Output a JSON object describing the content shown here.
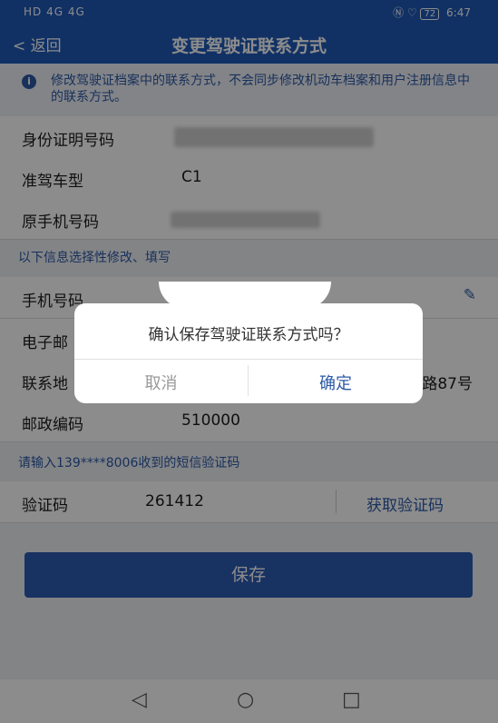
{
  "status_bar": {
    "left": "HD 4G 4G",
    "battery": "72",
    "time": "6:47"
  },
  "header": {
    "back_label": "返回",
    "title": "变更驾驶证联系方式"
  },
  "notice": {
    "text": "修改驾驶证档案中的联系方式，不会同步修改机动车档案和用户注册信息中的联系方式。"
  },
  "fields": [
    {
      "label": "身份证明号码",
      "value": ""
    },
    {
      "label": "准驾车型",
      "value": "C1"
    },
    {
      "label": "原手机号码",
      "value": ""
    }
  ],
  "section1": "以下信息选择性修改、填写",
  "edit_fields": [
    {
      "label": "手机号码",
      "value": ""
    },
    {
      "label": "电子邮",
      "value": ""
    },
    {
      "label": "联系地",
      "value": "路87号"
    },
    {
      "label": "邮政编码",
      "value": "510000"
    }
  ],
  "section2": "请输入139****8006收到的短信验证码",
  "code": {
    "label": "验证码",
    "value": "261412",
    "get_label": "获取验证码"
  },
  "save_label": "保存",
  "dialog": {
    "message": "确认保存驾驶证联系方式吗？",
    "cancel": "取消",
    "confirm": "确定"
  },
  "nav": {
    "back": "◁",
    "home": "○",
    "recent": "□"
  }
}
